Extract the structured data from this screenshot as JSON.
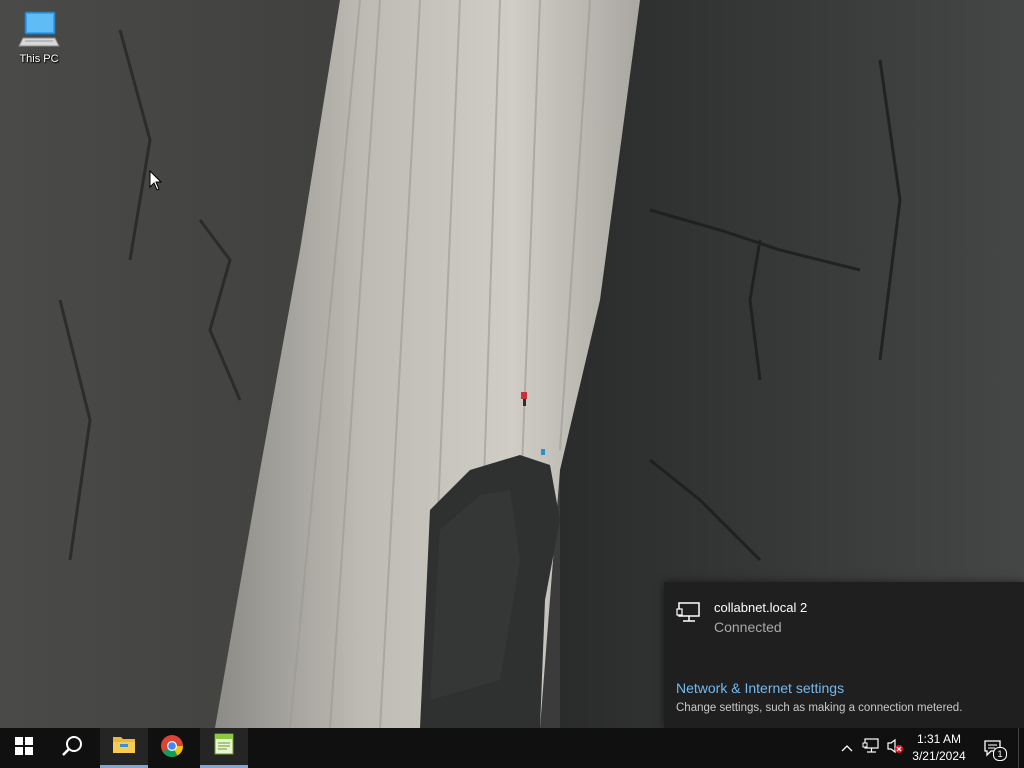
{
  "desktop": {
    "icons": [
      {
        "label": "This PC",
        "icon": "this-pc-icon"
      }
    ]
  },
  "network_flyout": {
    "network_name": "collabnet.local 2",
    "status": "Connected",
    "settings_link": "Network & Internet settings",
    "settings_description": "Change settings, such as making a connection metered."
  },
  "taskbar": {
    "apps": [
      {
        "name": "start",
        "icon": "windows-logo-icon"
      },
      {
        "name": "search",
        "icon": "search-icon"
      },
      {
        "name": "file-explorer",
        "icon": "folder-icon"
      },
      {
        "name": "chrome",
        "icon": "chrome-icon"
      },
      {
        "name": "notepad-plus",
        "icon": "notepad-icon"
      }
    ],
    "clock": {
      "time": "1:31 AM",
      "date": "3/21/2024"
    },
    "notification_count": "1"
  },
  "colors": {
    "taskbar": "#101010",
    "flyout": "#1f1f1f",
    "link": "#76b9ed",
    "accent": "#7ea7d8"
  }
}
